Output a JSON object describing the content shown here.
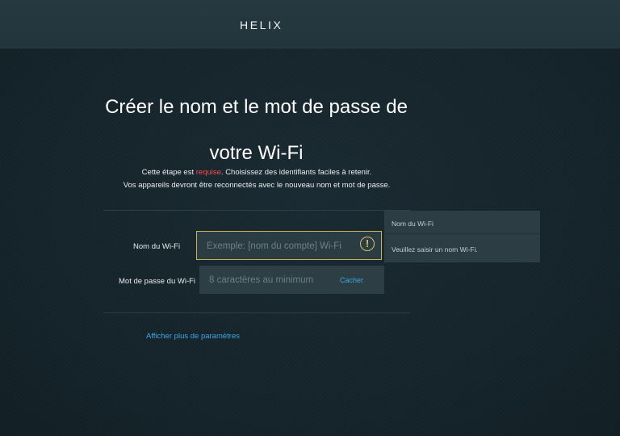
{
  "header": {
    "logo_text": "HELIX"
  },
  "main": {
    "title_line1": "Créer le nom et le mot de passe de",
    "title_line2": "votre Wi-Fi",
    "subtitle": {
      "line1_before": "Cette étape est ",
      "line1_required": "requise",
      "line1_after": ". Choisissez des identifiants faciles à retenir.",
      "line2": "Vos appareils devront être reconnectés avec le nouveau nom et mot de passe."
    }
  },
  "form": {
    "ssid_label": "Nom du Wi-Fi",
    "ssid_placeholder": "Exemple: [nom du compte] Wi-Fi",
    "ssid_value": "",
    "ssid_status": "warning",
    "password_label": "Mot de passe du Wi-Fi",
    "password_placeholder": "8 caractères au minimum",
    "password_value": "",
    "hide_label": "Cacher"
  },
  "tooltip": {
    "title": "Nom du Wi-Fi",
    "message": "Veuillez saisir un nom Wi-Fi."
  },
  "more_settings_label": "Afficher plus de paramètres",
  "colors": {
    "background": "#17252d",
    "accent_link": "#3ca8e2",
    "required": "#ff4a4a",
    "warning": "#d8c06a"
  },
  "icons": {
    "ssid_warning": "exclamation-circle-icon"
  }
}
